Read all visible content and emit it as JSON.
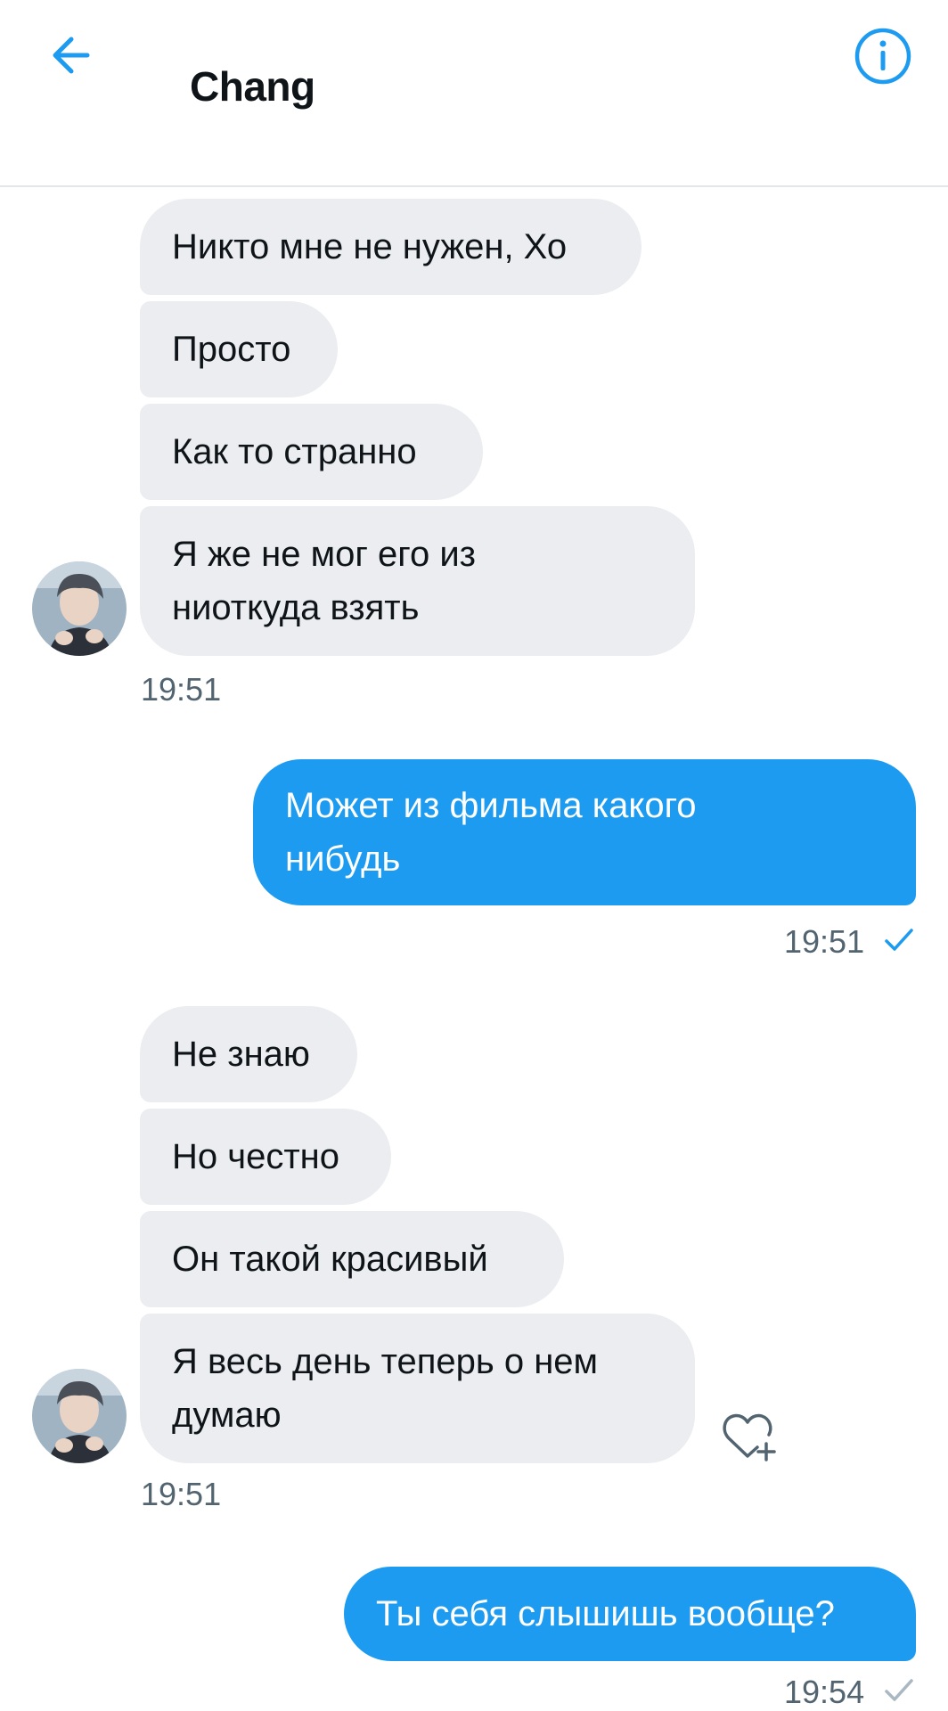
{
  "header": {
    "title": "Chang",
    "back_icon": "arrow-left-icon",
    "info_icon": "info-circle-icon"
  },
  "colors": {
    "accent": "#1d9bf0",
    "incoming_bubble": "#ebedf0",
    "text": "#0f1419",
    "muted": "#536471"
  },
  "messages": {
    "group1": {
      "m1": "Никто мне не нужен, Хо",
      "m2": "Просто",
      "m3": "Как то странно",
      "m4_line1": "Я же не мог его из",
      "m4_line2": "ниоткуда взять",
      "time": "19:51"
    },
    "out1": {
      "line1": "Может из фильма какого",
      "line2": "нибудь",
      "time": "19:51"
    },
    "group2": {
      "m1": "Не знаю",
      "m2": "Но честно",
      "m3": "Он такой красивый",
      "m4_line1": "Я весь день теперь о нем",
      "m4_line2": "думаю",
      "time": "19:51"
    },
    "out2": {
      "text": "Ты себя слышишь вообще?",
      "time": "19:54"
    }
  }
}
